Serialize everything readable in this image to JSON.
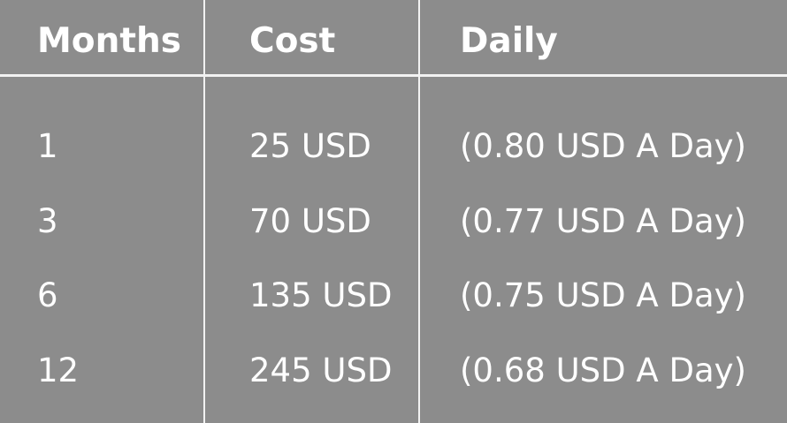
{
  "table": {
    "headers": [
      "Months",
      "Cost",
      "Daily"
    ],
    "rows": [
      [
        "1",
        "25 USD",
        "(0.80 USD A Day)"
      ],
      [
        "3",
        "70 USD",
        "(0.77 USD A Day)"
      ],
      [
        "6",
        "135 USD",
        "(0.75 USD A Day)"
      ],
      [
        "12",
        "245 USD",
        "(0.68 USD A Day)"
      ]
    ]
  },
  "colors": {
    "background": "#8c8c8c",
    "text": "#ffffff",
    "rule": "#f2f2f2"
  }
}
